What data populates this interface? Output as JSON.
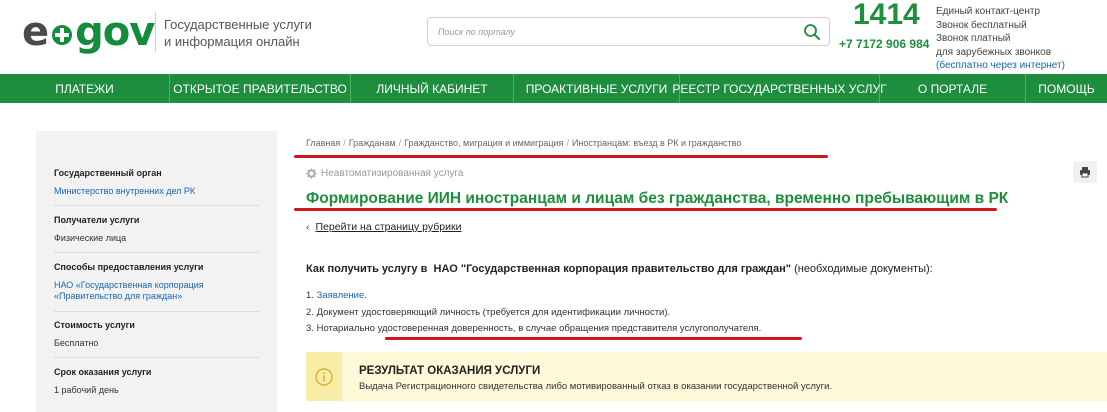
{
  "header": {
    "logo_e": "e",
    "logo_gov": "gov",
    "tagline_line1": "Государственные услуги",
    "tagline_line2": "и информация онлайн",
    "search_placeholder": "Поиск по порталу",
    "phone_short": "1414",
    "phone_full": "+7 7172 906 984",
    "contact_line1": "Единый контакт-центр",
    "contact_line2": "Звонок бесплатный",
    "contact_line3": "Звонок платный",
    "contact_line4": "для зарубежных звонков",
    "contact_line5": "(бесплатно через интернет)"
  },
  "nav": {
    "items": [
      "ПЛАТЕЖИ",
      "ОТКРЫТОЕ ПРАВИТЕЛЬСТВО",
      "ЛИЧНЫЙ КАБИНЕТ",
      "ПРОАКТИВНЫЕ УСЛУГИ",
      "РЕЕСТР ГОСУДАРСТВЕННЫХ УСЛУГ",
      "О ПОРТАЛЕ",
      "ПОМОЩЬ"
    ]
  },
  "sidebar": {
    "blocks": [
      {
        "title": "Государственный орган",
        "value": "Министерство внутренних дел РК"
      },
      {
        "title": "Получатели услуги",
        "value": "Физические лица"
      },
      {
        "title": "Способы предоставления услуги",
        "value_line1": "НАО «Государственная корпорация",
        "value_line2": "«Правительство для граждан»"
      },
      {
        "title": "Стоимость услуги",
        "value": "Бесплатно"
      },
      {
        "title": "Срок оказания услуги",
        "value": "1 рабочий день"
      }
    ]
  },
  "main": {
    "breadcrumb": [
      "Главная",
      "Гражданам",
      "Гражданство, миграция и иммиграция",
      "Иностранцам: въезд в РК и гражданство"
    ],
    "breadcrumb_sep": "/",
    "service_type": "Неавтоматизированная услуга",
    "title": "Формирование ИИН иностранцам и лицам без гражданства, временно пребывающим в РК",
    "back_chevron": "‹",
    "back_link": "Перейти на страницу рубрики",
    "how_to_prefix": "Как получить услугу в",
    "how_to_org": "НАО \"Государственная корпорация правительство для граждан\"",
    "how_to_suffix": "(необходимые документы):",
    "docs": [
      {
        "num": "1.",
        "text": "Заявление",
        "tail": "."
      },
      {
        "num": "2.",
        "text": "Документ удостоверяющий личность (требуется для идентификации личности)."
      },
      {
        "num": "3.",
        "text": "Нотариально удостоверенная доверенность, в случае обращения представителя услугополучателя."
      }
    ],
    "result_title": "РЕЗУЛЬТАТ ОКАЗАНИЯ УСЛУГИ",
    "result_text": "Выдача Регистрационного свидетельства либо мотивированный отказ в оказании государственной услуги."
  },
  "icons": {
    "logo_dot": "logo-plus-icon",
    "search": "search-icon",
    "gear": "gear-icon",
    "print": "printer-icon",
    "info": "info-icon"
  },
  "colors": {
    "brand_green": "#1e8e3e",
    "link_blue": "#1a64b3",
    "annotation_red": "#d4141d",
    "result_bg": "#fcf8d8"
  }
}
